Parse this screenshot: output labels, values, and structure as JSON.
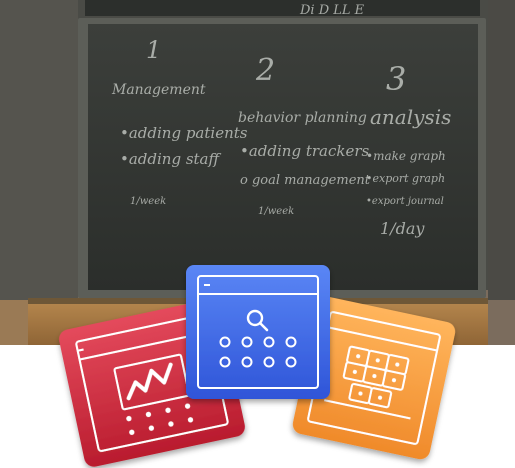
{
  "photo": {
    "top_scribble": "Di  D  LL  E",
    "columns": [
      {
        "number": "1",
        "heading": "Management",
        "items": [
          "•adding patients",
          "•adding staff"
        ],
        "frequency": "1/week"
      },
      {
        "number": "2",
        "heading": "behavior planning",
        "items": [
          "•adding trackers",
          "o goal management"
        ],
        "frequency": "1/week"
      },
      {
        "number": "3",
        "heading": "analysis",
        "items": [
          "•make graph",
          "•export graph",
          "•export journal"
        ],
        "frequency": "1/day"
      }
    ]
  },
  "icons": [
    {
      "name": "analysis-chart-icon",
      "color_top": "#e44a5c",
      "color_bottom": "#b91c2e"
    },
    {
      "name": "search-calendar-icon",
      "color_top": "#5a86f5",
      "color_bottom": "#2f55d8"
    },
    {
      "name": "grid-board-icon",
      "color_top": "#ffb55c",
      "color_bottom": "#f08a2a"
    }
  ]
}
